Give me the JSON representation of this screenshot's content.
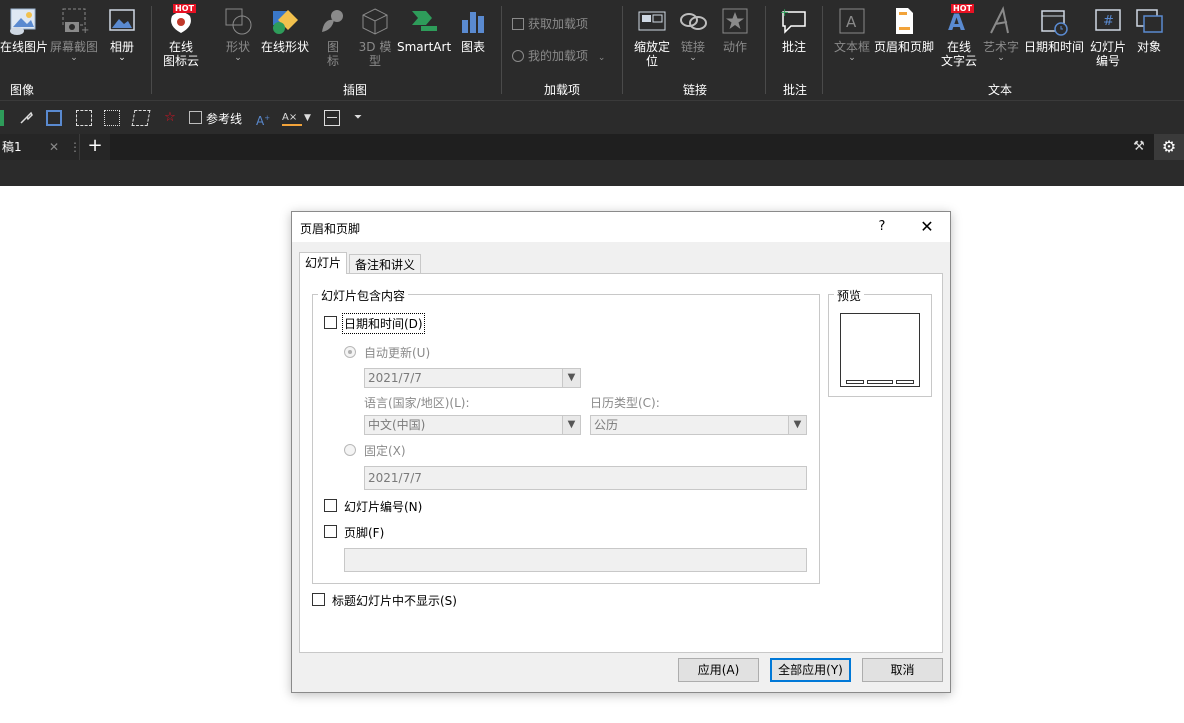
{
  "ribbon": {
    "buttons": {
      "online_image": "在线图片",
      "screenshot": "屏幕截图",
      "album": "相册",
      "online_icons_line1": "在线",
      "online_icons_line2": "图标云",
      "shapes": "形状",
      "online_shapes": "在线形状",
      "icons_line1": "图",
      "icons_line2": "标",
      "models_line1": "3D 模",
      "models_line2": "型",
      "smartart": "SmartArt",
      "chart": "图表",
      "get_addins": "获取加载项",
      "my_addins": "我的加载项",
      "zoom_line1": "缩放定",
      "zoom_line2": "位",
      "link": "链接",
      "action": "动作",
      "comment": "批注",
      "textbox": "文本框",
      "header_footer": "页眉和页脚",
      "online_text_line1": "在线",
      "online_text_line2": "文字云",
      "wordart": "艺术字",
      "datetime": "日期和时间",
      "slide_num_line1": "幻灯片",
      "slide_num_line2": "编号",
      "object": "对象"
    },
    "hot_badge": "HOT",
    "groups": {
      "images": "图像",
      "illustrations": "插图",
      "addins": "加载项",
      "links": "链接",
      "comments": "批注",
      "text": "文本"
    }
  },
  "quickbar": {
    "guides_label": "参考线"
  },
  "tabs": {
    "doc_tab": "稿1",
    "add_tab": "+"
  },
  "dialog": {
    "title": "页眉和页脚",
    "help": "?",
    "close": "✕",
    "tabs": [
      "幻灯片",
      "备注和讲义"
    ],
    "include_group": "幻灯片包含内容",
    "preview_group": "预览",
    "date_time": "日期和时间(D)",
    "auto_update": "自动更新(U)",
    "date_value": "2021/7/7",
    "language_label": "语言(国家/地区)(L):",
    "language_value": "中文(中国)",
    "calendar_label": "日历类型(C):",
    "calendar_value": "公历",
    "fixed": "固定(X)",
    "fixed_value": "2021/7/7",
    "slide_number": "幻灯片编号(N)",
    "footer": "页脚(F)",
    "footer_value": "",
    "dont_show_title": "标题幻灯片中不显示(S)",
    "buttons": {
      "apply": "应用(A)",
      "apply_all": "全部应用(Y)",
      "cancel": "取消"
    }
  }
}
